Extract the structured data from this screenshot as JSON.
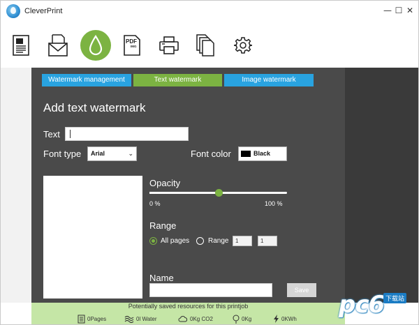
{
  "window": {
    "title": "CleverPrint",
    "buttons": {
      "minimize": "—",
      "maximize": "☐",
      "close": "✕"
    }
  },
  "toolbar": {
    "items": [
      {
        "icon": "document-icon"
      },
      {
        "icon": "envelope-icon"
      },
      {
        "icon": "water-drop-icon",
        "active": true
      },
      {
        "icon": "pdf-img-icon",
        "label": "PDF",
        "sublabel": "IMG"
      },
      {
        "icon": "printer-icon"
      },
      {
        "icon": "copies-icon"
      },
      {
        "icon": "gear-icon"
      }
    ]
  },
  "tabs": [
    "Watermark management",
    "Text watermark",
    "Image watermark"
  ],
  "panel": {
    "heading": "Add text watermark",
    "text_label": "Text",
    "text_value": "",
    "font_type_label": "Font type",
    "font_type_value": "Arial",
    "font_color_label": "Font color",
    "font_color_value": "Black",
    "font_color_hex": "#000000",
    "opacity_label": "Opacity",
    "opacity_min": "0 %",
    "opacity_max": "100 %",
    "opacity_value": 0.5,
    "range_label": "Range",
    "range_all_pages": "All pages",
    "range_range": "Range",
    "range_from": "1",
    "range_to": "1",
    "name_label": "Name",
    "name_value": "",
    "save_label": "Save"
  },
  "footer": {
    "title": "Potentially saved resources for this printjob",
    "stats": [
      {
        "icon": "pages-icon",
        "text": "0Pages"
      },
      {
        "icon": "water-icon",
        "text": "0l Water"
      },
      {
        "icon": "cloud-icon",
        "text": "0Kg CO2"
      },
      {
        "icon": "tree-icon",
        "text": "0Kg"
      },
      {
        "icon": "energy-icon",
        "text": "0KWh"
      }
    ]
  },
  "watermark_logo": {
    "text": "pc6",
    "badge": "下载站"
  },
  "colors": {
    "accent_green": "#7cb342",
    "accent_blue": "#29a3e0",
    "panel_bg": "#4a4a4a",
    "footer_bg": "#c5e6a6"
  }
}
